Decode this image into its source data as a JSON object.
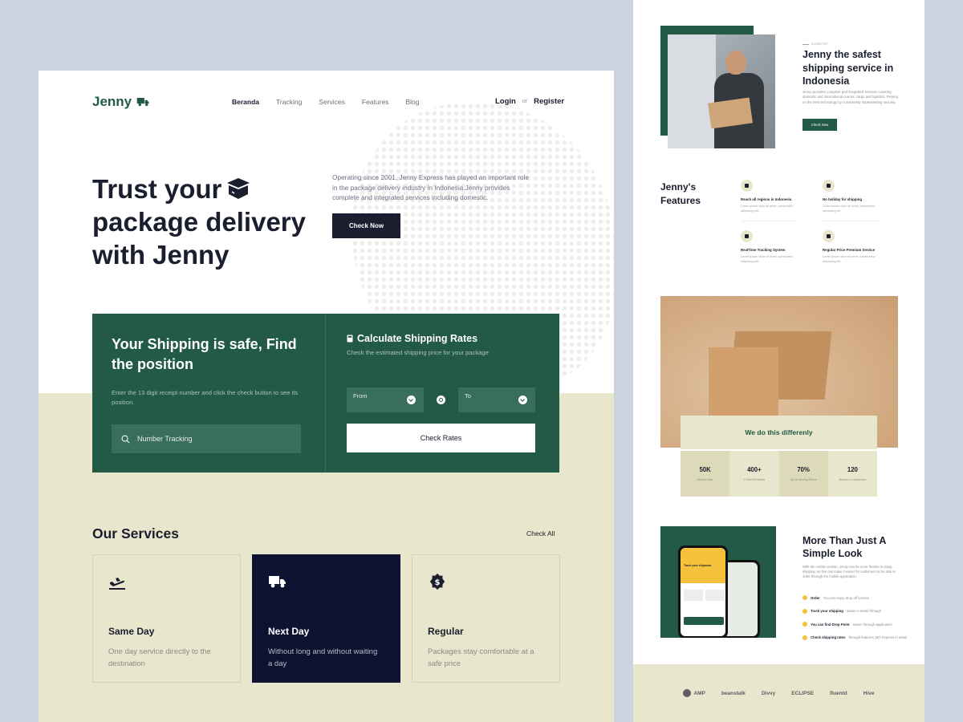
{
  "left": {
    "brand": "Jenny",
    "nav": [
      "Beranda",
      "Tracking",
      "Services",
      "Features",
      "Blog"
    ],
    "auth": {
      "login": "Login",
      "or": "or",
      "register": "Register"
    },
    "hero": {
      "title": "Trust your package delivery with Jenny",
      "title_line1": "Trust your",
      "title_line2": "package delivery",
      "title_line3": "with Jenny",
      "description": "Operating since 2001, Jenny Express has played an important role in the package delivery industry in Indonesia.Jenny provides complete and integrated services including domestic.",
      "cta": "Check Now"
    },
    "shipping": {
      "title": "Your Shipping is safe, Find the position",
      "description": "Enter the 13 digit receipt number and click the check button to see its position.",
      "tracking_placeholder": "Number Tracking",
      "calc_title": "Calculate Shipping Rates",
      "calc_sub": "Check the estimated shipping price for your package",
      "from": "From",
      "to": "To",
      "check_rates": "Check Rates"
    },
    "services": {
      "title": "Our Services",
      "check_all": "Check All",
      "items": [
        {
          "title": "Same Day",
          "desc": "One day service directly to the destination",
          "icon": "airplane-landing-icon"
        },
        {
          "title": "Next Day",
          "desc": "Without long and without waiting a day",
          "icon": "truck-icon"
        },
        {
          "title": "Regular",
          "desc": "Packages stay comfortable at a safe price",
          "icon": "dollar-badge-icon"
        }
      ]
    }
  },
  "right": {
    "tiny_label": "SLIDER TOP",
    "title": "Jenny the safest shipping service in Indonesia",
    "desc": "Jenny provides complete and integrated services covering domestic and international courier, cargo and logistics. Relying on the best technology by consistently implementing security.",
    "cta": "Check Now",
    "features": {
      "title": "Jenny's Features",
      "items": [
        {
          "title": "Reach all regions in Indonesia",
          "desc": "Lorem ipsum dolor sit amet, consectetur adipiscing elit."
        },
        {
          "title": "No holiday for shipping",
          "desc": "Lorem ipsum dolor sit amet, consectetur adipiscing elit."
        },
        {
          "title": "RealTime Tracking System",
          "desc": "Lorem ipsum dolor sit amet, consectetur adipiscing elit."
        },
        {
          "title": "Regular Price Premium Service",
          "desc": "Lorem ipsum dolor sit amet, consectetur adipiscing elit."
        }
      ]
    },
    "differently": {
      "title": "We do this differenly",
      "stats": [
        {
          "value": "50K",
          "label": "Global User"
        },
        {
          "value": "400+",
          "label": "5 Start Reviews"
        },
        {
          "value": "70%",
          "label": "Up to Saving Rates"
        },
        {
          "value": "120",
          "label": "Branch in Indonesia"
        }
      ]
    },
    "app": {
      "phone_header": "Track your shipment",
      "title": "More Than Just A Simple Look",
      "desc": "With the mobile version, Jenny can be more flexible in doing shipping, so this can make it easier for customers to be able to order through the mobile application",
      "list": [
        {
          "bold": "Order",
          "rest": "You can enjoy drop off service"
        },
        {
          "bold": "Track your shipping",
          "rest": "status in detail through"
        },
        {
          "bold": "You can find Drop Point",
          "rest": "easier through application"
        },
        {
          "bold": "Check shipping rates",
          "rest": "through features J&T Express in detail"
        }
      ]
    },
    "partners": [
      "AMP",
      "beanstalk",
      "Divvy",
      "ECLIPSE",
      "fluentd",
      "Hive"
    ]
  },
  "colors": {
    "brand_green": "#225A45",
    "beige": "#E8E6CC",
    "navy": "#0D1230",
    "ink": "#1A1E2E",
    "accent_yellow": "#F6C23B"
  }
}
